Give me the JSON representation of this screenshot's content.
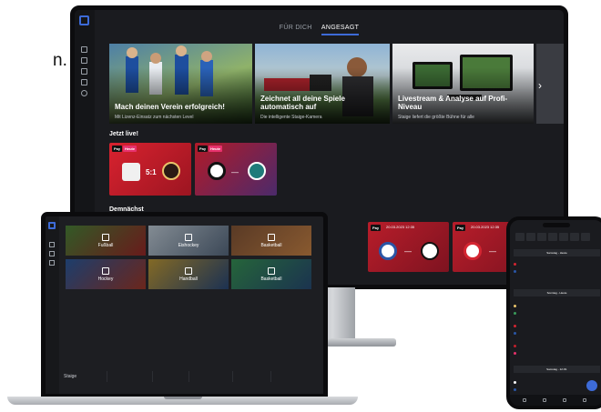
{
  "intro_text": "n.",
  "monitor": {
    "tabs": [
      {
        "label": "FÜR DICH",
        "active": false
      },
      {
        "label": "ANGESAGT",
        "active": true
      }
    ],
    "hero_cards": [
      {
        "title": "Mach deinen Verein erfolgreich!",
        "subtitle": "Mit Lizenz-Einsatz zum nächsten Level",
        "scene": "football-players"
      },
      {
        "title": "Zeichnet all deine Spiele automatisch auf",
        "subtitle": "Die intelligente Staige-Kamera",
        "scene": "camera-operator"
      },
      {
        "title": "Livestream & Analyse auf Profi-Niveau",
        "subtitle": "Staige liefert die größte Bühne für alle",
        "scene": "screens"
      }
    ],
    "live_section": "Jetzt live!",
    "live_cards": [
      {
        "badges": [
          "Pay",
          "Heute"
        ],
        "score": "5:1"
      },
      {
        "badges": [
          "Pay",
          "Heute"
        ],
        "score": "—"
      }
    ],
    "upcoming_section": "Demnächst",
    "upcoming_cards": [
      {
        "badge": "Pay",
        "time": "20.03.2023 12:35"
      },
      {
        "badge": "Pay",
        "time": "20.03.2023 12:35"
      }
    ],
    "colors": {
      "accent": "#3d6bd8",
      "bg": "#1a1b1f",
      "live_red": "#c41e2d",
      "badge_pink": "#e6316c"
    }
  },
  "laptop": {
    "tiles": [
      {
        "label": "Fußball"
      },
      {
        "label": "Eishockey"
      },
      {
        "label": "Basketball"
      },
      {
        "label": "Hockey"
      },
      {
        "label": "Handball"
      },
      {
        "label": "Basketball"
      }
    ],
    "footer": {
      "logo": "Staige"
    }
  },
  "phone": {
    "sections": [
      "Samstag - Heute",
      "Sonntag - Heute",
      "Samstag - 12.03."
    ]
  }
}
